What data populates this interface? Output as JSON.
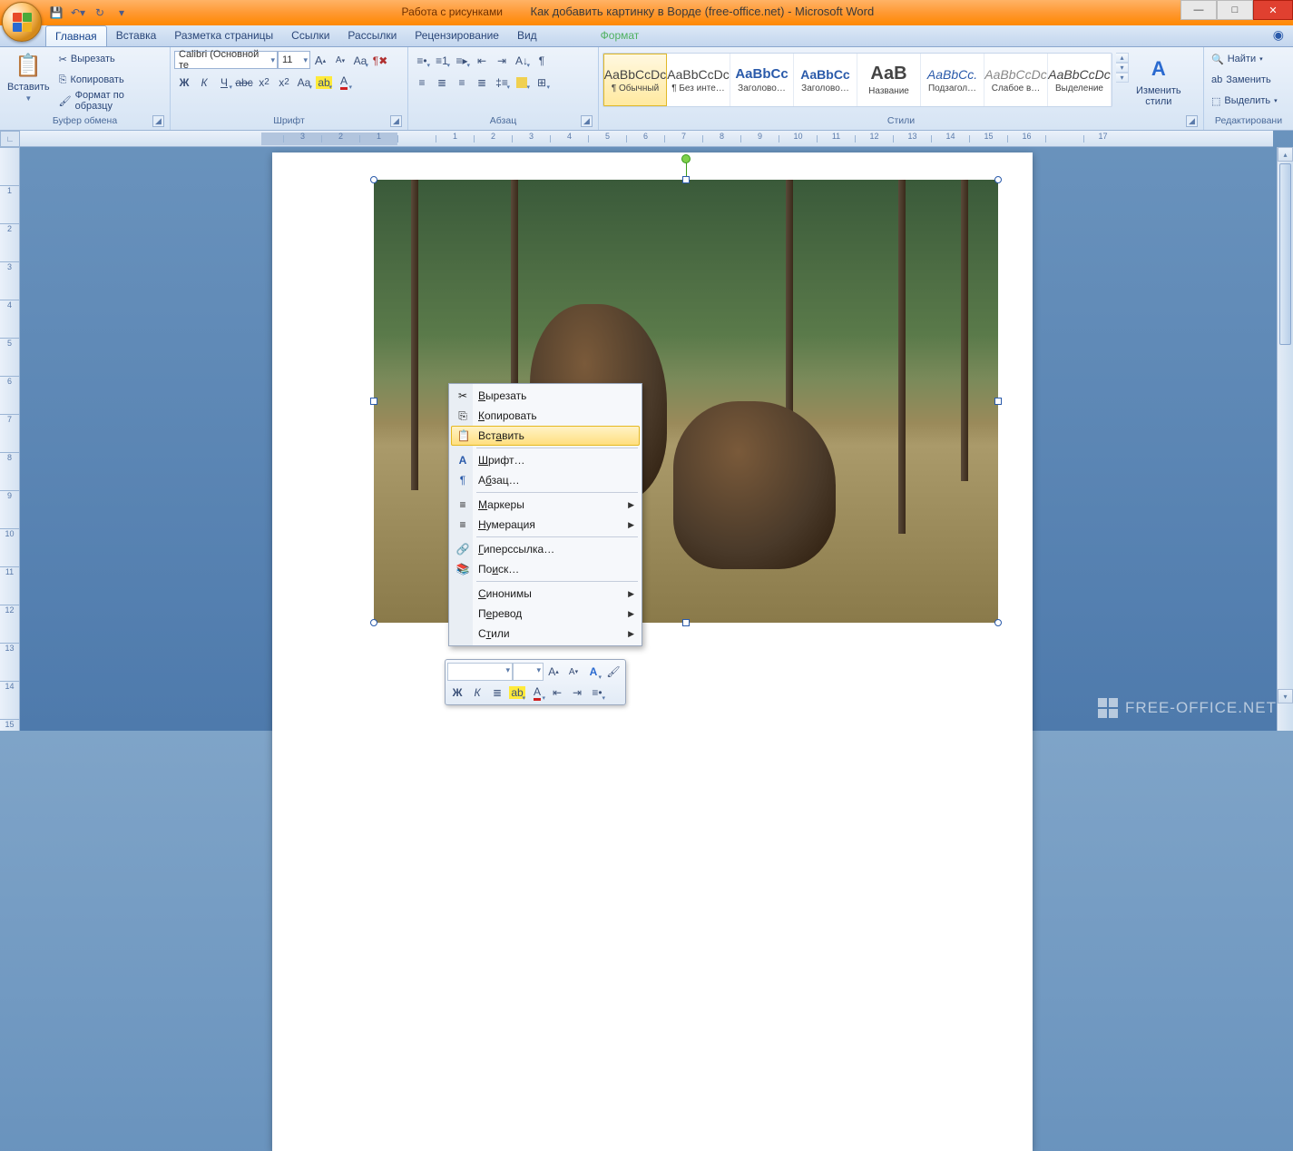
{
  "titlebar": {
    "context_label": "Работа с рисунками",
    "title": "Как добавить картинку в Ворде (free-office.net) - Microsoft Word"
  },
  "tabs": {
    "home": "Главная",
    "insert": "Вставка",
    "page_layout": "Разметка страницы",
    "references": "Ссылки",
    "mailings": "Рассылки",
    "review": "Рецензирование",
    "view": "Вид",
    "format": "Формат"
  },
  "ribbon": {
    "clipboard": {
      "label": "Буфер обмена",
      "paste": "Вставить",
      "cut": "Вырезать",
      "copy": "Копировать",
      "format_painter": "Формат по образцу"
    },
    "font": {
      "label": "Шрифт",
      "name": "Calibri (Основной те",
      "size": "11"
    },
    "paragraph": {
      "label": "Абзац"
    },
    "styles": {
      "label": "Стили",
      "items": [
        {
          "preview": "AaBbCcDc",
          "name": "¶ Обычный",
          "selected": true
        },
        {
          "preview": "AaBbCcDc",
          "name": "¶ Без инте…"
        },
        {
          "preview": "AaBbCc",
          "name": "Заголово…",
          "color": "#2a5aaa",
          "bold": true,
          "size": "15px"
        },
        {
          "preview": "AaBbCc",
          "name": "Заголово…",
          "color": "#2a5aaa",
          "bold": true,
          "size": "14px"
        },
        {
          "preview": "АаВ",
          "name": "Название",
          "bold": true,
          "size": "20px"
        },
        {
          "preview": "AaBbCc.",
          "name": "Подзагол…",
          "color": "#2a5aaa",
          "italic": true
        },
        {
          "preview": "AaBbCcDc",
          "name": "Слабое в…",
          "color": "#888",
          "italic": true
        },
        {
          "preview": "AaBbCcDc",
          "name": "Выделение",
          "italic": true
        }
      ],
      "change_styles": "Изменить\nстили"
    },
    "editing": {
      "label": "Редактировани",
      "find": "Найти",
      "replace": "Заменить",
      "select": "Выделить"
    }
  },
  "ruler": [
    "3",
    "2",
    "1",
    "",
    "1",
    "2",
    "3",
    "4",
    "5",
    "6",
    "7",
    "8",
    "9",
    "10",
    "11",
    "12",
    "13",
    "14",
    "15",
    "16",
    "",
    "17"
  ],
  "ruler_v": [
    "",
    "1",
    "2",
    "3",
    "4",
    "5",
    "6",
    "7",
    "8",
    "9",
    "10",
    "11",
    "12",
    "13",
    "14",
    "15"
  ],
  "context_menu": {
    "cut": "Вырезать",
    "copy": "Копировать",
    "paste": "Вставить",
    "font": "Шрифт…",
    "paragraph": "Абзац…",
    "bullets": "Маркеры",
    "numbering": "Нумерация",
    "hyperlink": "Гиперссылка…",
    "lookup": "Поиск…",
    "synonyms": "Синонимы",
    "translate": "Перевод",
    "styles": "Стили"
  },
  "watermark": "FREE-OFFICE.NET"
}
